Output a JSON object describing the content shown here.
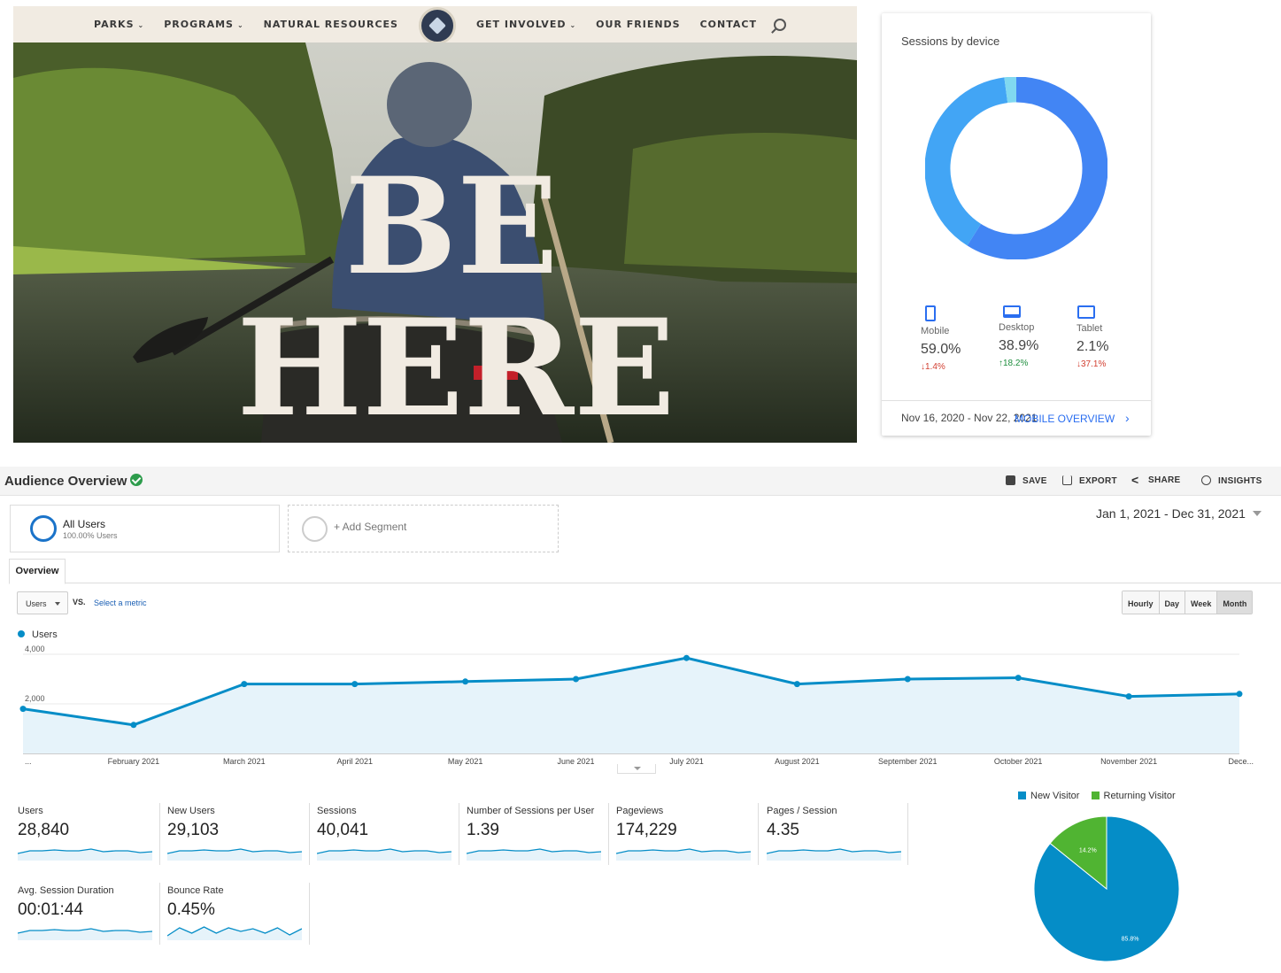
{
  "website": {
    "nav": {
      "items_left": [
        {
          "label": "PARKS",
          "dropdown": true
        },
        {
          "label": "PROGRAMS",
          "dropdown": true
        },
        {
          "label": "NATURAL RESOURCES",
          "dropdown": false
        }
      ],
      "items_right": [
        {
          "label": "GET INVOLVED",
          "dropdown": true
        },
        {
          "label": "OUR FRIENDS",
          "dropdown": false
        },
        {
          "label": "CONTACT",
          "dropdown": false
        }
      ],
      "logo_icon": "eagle-badge-logo",
      "search_icon": "search-icon"
    },
    "hero": {
      "headline_line1": "BE",
      "headline_line2": "HERE"
    }
  },
  "device_card": {
    "title": "Sessions by device",
    "devices": [
      {
        "name": "Mobile",
        "percent": "59.0%",
        "change": "1.4%",
        "direction": "down",
        "share": 59.0,
        "color": "#4285f4",
        "icon": "mobile-icon"
      },
      {
        "name": "Desktop",
        "percent": "38.9%",
        "change": "18.2%",
        "direction": "up",
        "share": 38.9,
        "color": "#42a5f5",
        "icon": "desktop-icon"
      },
      {
        "name": "Tablet",
        "percent": "2.1%",
        "change": "37.1%",
        "direction": "down",
        "share": 2.1,
        "color": "#80d8f0",
        "icon": "tablet-icon"
      }
    ],
    "date_range": "Nov 16, 2020 - Nov 22, 2021",
    "link": "MOBILE OVERVIEW"
  },
  "analytics": {
    "title": "Audience Overview",
    "toolbar": {
      "save": "SAVE",
      "export": "EXPORT",
      "share": "SHARE",
      "insights": "INSIGHTS"
    },
    "segments": {
      "active_name": "All Users",
      "active_sub": "100.00% Users",
      "add": "+ Add Segment"
    },
    "date_range": "Jan 1, 2021 - Dec 31, 2021",
    "tab": "Overview",
    "metric_select": "Users",
    "vs": "VS.",
    "select_metric": "Select a metric",
    "granularity": [
      "Hourly",
      "Day",
      "Week",
      "Month"
    ],
    "granularity_selected": "Month",
    "legend": "Users",
    "metrics": [
      {
        "name": "Users",
        "value": "28,840"
      },
      {
        "name": "New Users",
        "value": "29,103"
      },
      {
        "name": "Sessions",
        "value": "40,041"
      },
      {
        "name": "Number of Sessions per User",
        "value": "1.39"
      },
      {
        "name": "Pageviews",
        "value": "174,229"
      },
      {
        "name": "Pages / Session",
        "value": "4.35"
      },
      {
        "name": "Avg. Session Duration",
        "value": "00:01:44"
      },
      {
        "name": "Bounce Rate",
        "value": "0.45%"
      }
    ],
    "pie_legend": {
      "new": "New Visitor",
      "returning": "Returning Visitor"
    }
  },
  "chart_data": [
    {
      "type": "line",
      "series": [
        {
          "name": "Users",
          "values": [
            1800,
            1150,
            2800,
            2800,
            2900,
            3000,
            3850,
            2800,
            3000,
            3050,
            2300,
            2400
          ]
        }
      ],
      "categories": [
        "...",
        "February 2021",
        "March 2021",
        "April 2021",
        "May 2021",
        "June 2021",
        "July 2021",
        "August 2021",
        "September 2021",
        "October 2021",
        "November 2021",
        "Dece..."
      ],
      "ytick_labels": [
        "4,000",
        "2,000"
      ],
      "ylim": [
        0,
        4000
      ],
      "color": "#058dc7"
    },
    {
      "type": "pie",
      "slices": [
        {
          "label": "New Visitor",
          "value": 85.8,
          "text": "85.8%",
          "color": "#058dc7"
        },
        {
          "label": "Returning Visitor",
          "value": 14.2,
          "text": "14.2%",
          "color": "#50b432"
        }
      ]
    },
    {
      "type": "pie",
      "slices": [
        {
          "label": "Mobile",
          "value": 59.0
        },
        {
          "label": "Desktop",
          "value": 38.9
        },
        {
          "label": "Tablet",
          "value": 2.1
        }
      ]
    }
  ]
}
